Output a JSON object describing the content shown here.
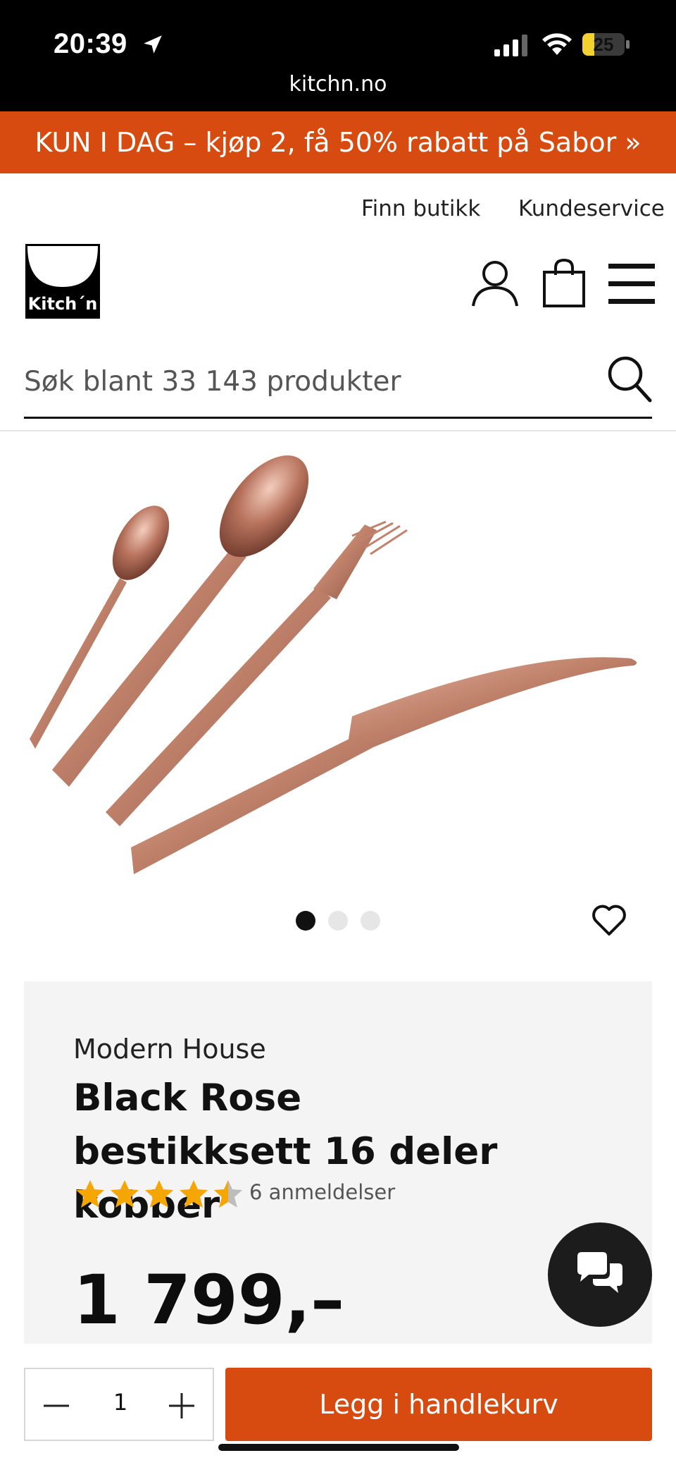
{
  "status_bar": {
    "time": "20:39",
    "battery": "25",
    "url": "kitchn.no"
  },
  "promo_banner": "KUN I DAG – kjøp 2, få 50% rabatt på Sabor »",
  "top_links": {
    "find_store": "Finn butikk",
    "customer_service": "Kundeservice"
  },
  "logo": {
    "text": "Kitch´n"
  },
  "search": {
    "placeholder": "Søk blant 33 143 produkter"
  },
  "carousel": {
    "count": 3,
    "active_index": 0
  },
  "product": {
    "brand": "Modern House",
    "title": "Black Rose bestikksett 16 deler kobber",
    "rating": 4.5,
    "rating_max": 5,
    "reviews": "6 anmeldelser",
    "price": "1 799,–"
  },
  "quantity": {
    "value": "1"
  },
  "cart_button": "Legg i handlekurv",
  "colors": {
    "accent": "#d74b11",
    "panel": "#f5f4f4",
    "star": "#f5a600",
    "copper": "#c98b74"
  }
}
